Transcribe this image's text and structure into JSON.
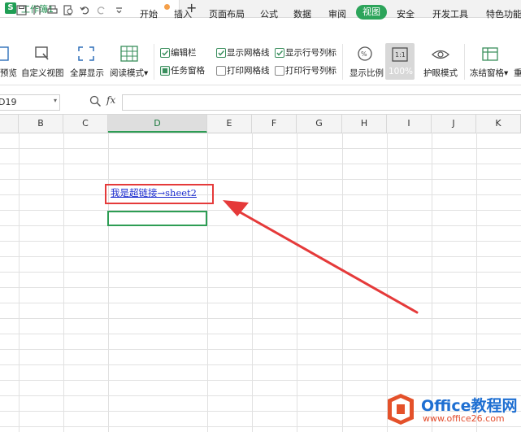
{
  "window": {
    "tab_title": "工作簿1",
    "app_icon_letter": "S",
    "new_tab_symbol": "+"
  },
  "menu": {
    "items": [
      "开始",
      "插入",
      "页面布局",
      "公式",
      "数据",
      "审阅",
      "视图",
      "安全",
      "开发工具",
      "特色功能"
    ],
    "active": "视图"
  },
  "ribbon": {
    "buttons": [
      "预览",
      "自定义视图",
      "全屏显示",
      "阅读模式",
      "显示比例",
      "100%",
      "护眼模式",
      "冻结窗格"
    ],
    "reading_mode_caret": "▾",
    "freeze_caret": "▾",
    "checkboxes": [
      {
        "label": "编辑栏",
        "checked": true
      },
      {
        "label": "显示网格线",
        "checked": true
      },
      {
        "label": "显示行号列标",
        "checked": true
      },
      {
        "label": "任务窗格",
        "checked": true
      },
      {
        "label": "打印网格线",
        "checked": false
      },
      {
        "label": "打印行号列标",
        "checked": false
      }
    ],
    "cut_off_label": "重"
  },
  "formula_bar": {
    "name_box": "D19",
    "fx_label": "fx",
    "value": ""
  },
  "columns": [
    "B",
    "C",
    "D",
    "E",
    "F",
    "G",
    "H",
    "I",
    "J",
    "K"
  ],
  "selected_column": "D",
  "cell_link": "我是超链接→sheet2",
  "watermark": {
    "name": "Office教程网",
    "url": "www.office26.com"
  },
  "colors": {
    "accent_green": "#2ca45a",
    "annotation_red": "#e53a3a",
    "link_blue": "#1d2ed0"
  }
}
